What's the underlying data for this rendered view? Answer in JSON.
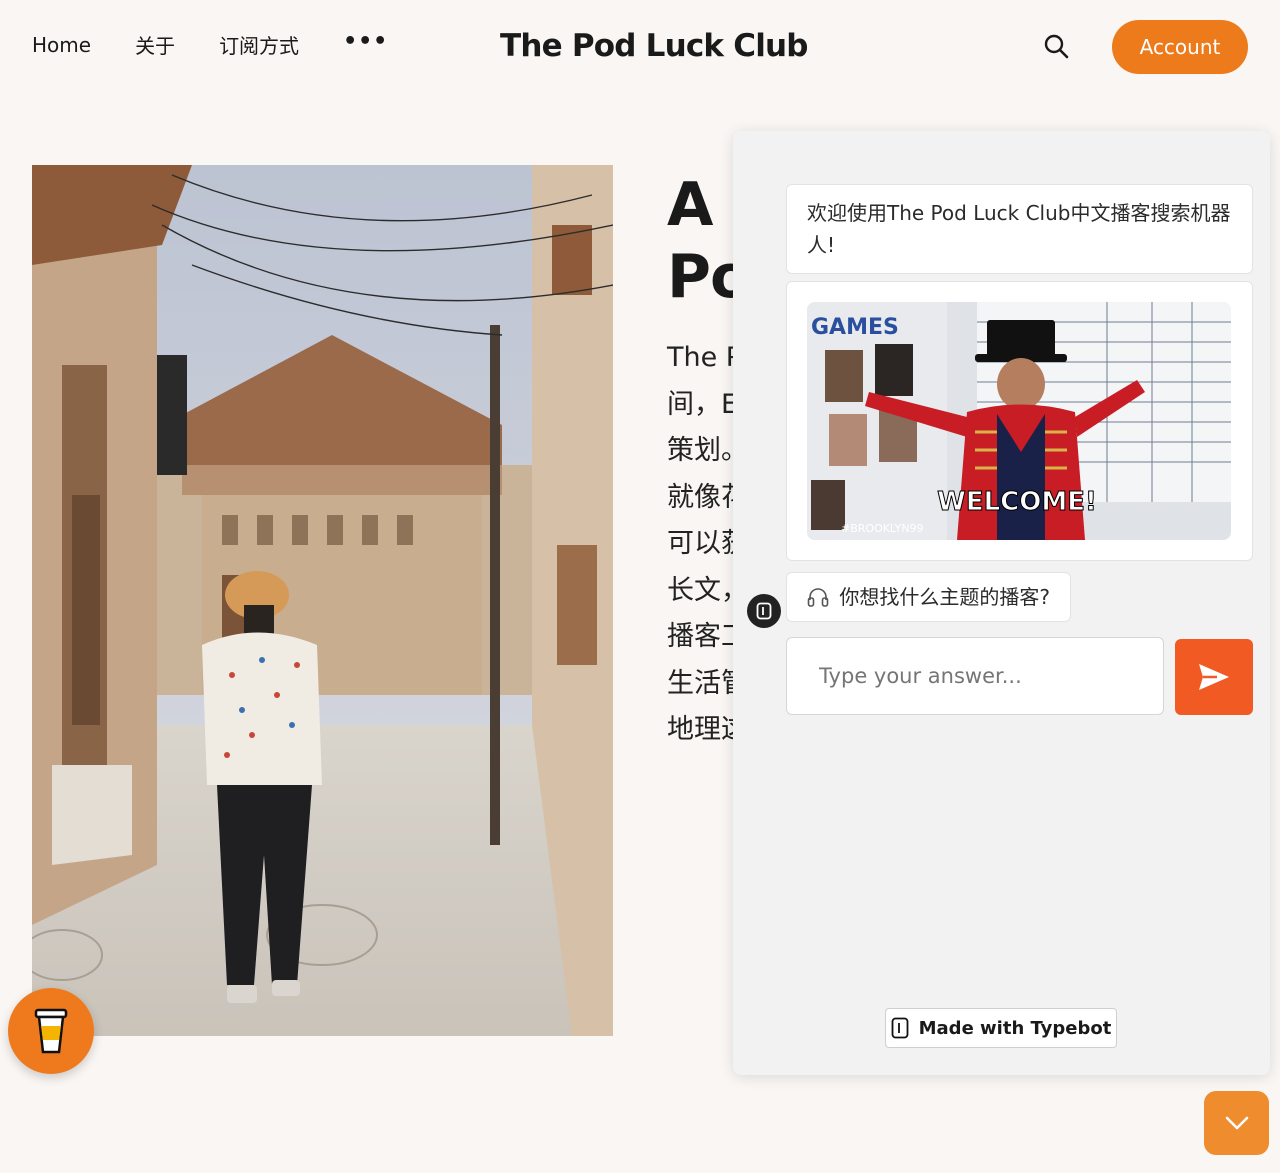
{
  "nav": {
    "items": [
      {
        "label": "Home"
      },
      {
        "label": "关于"
      },
      {
        "label": "订阅方式"
      }
    ],
    "more_label": "•••"
  },
  "site": {
    "title": "The Pod Luck Club"
  },
  "header": {
    "account_label": "Account",
    "search_icon": "search-icon",
    "accent_color": "#ed7b1c"
  },
  "article": {
    "title_lines": [
      "A N",
      "Po"
    ],
    "body_lines": [
      "The P",
      "间，E",
      "策划。",
      "就像花",
      "可以获",
      "长文，",
      "播客工",
      "生活管",
      "地理这"
    ]
  },
  "chat": {
    "welcome_text": "欢迎使用The Pod Luck Club中文播客搜索机器人!",
    "gif_caption": "WELCOME!",
    "gif_board_label": "GAMES",
    "gif_hashtag": "#BROOKLYN99",
    "question_icon": "headphones-icon",
    "question_text": "你想找什么主题的播客?",
    "input_placeholder": "Type your answer...",
    "send_icon": "send-icon",
    "send_color": "#f15a22",
    "badge_label": "Made with Typebot"
  },
  "floating": {
    "coffee_icon": "coffee-cup-icon",
    "collapse_icon": "chevron-down-icon"
  }
}
